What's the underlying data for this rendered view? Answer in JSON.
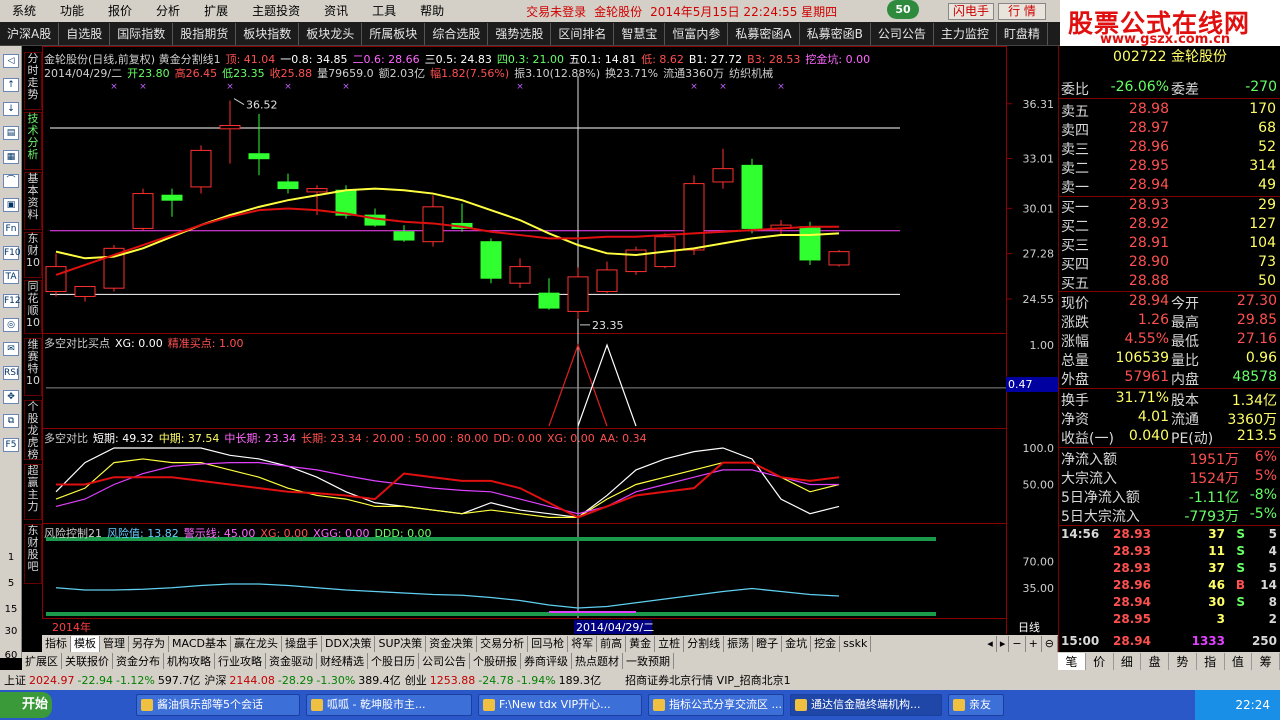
{
  "menu": [
    "系统",
    "功能",
    "报价",
    "分析",
    "扩展",
    "主题投资",
    "资讯",
    "工具",
    "帮助"
  ],
  "menu_status": {
    "login": "交易未登录",
    "stock": "金轮股份",
    "datetime": "2014年5月15日 22:24:55 星期四",
    "badge": "50",
    "flash": "闪电手",
    "quote": "行 情"
  },
  "logo": {
    "title": "股票公式在线网",
    "url": "www.gszx.com.cn"
  },
  "toolbar": [
    "沪深A股",
    "自选股",
    "国际指数",
    "股指期货",
    "板块指数",
    "板块龙头",
    "所属板块",
    "综合选股",
    "强势选股",
    "区间排名",
    "智慧宝",
    "恒富内参",
    "私募密函A",
    "私募密函B",
    "公司公告",
    "主力监控",
    "盯盘精"
  ],
  "left_tabs": [
    "分时走势",
    "技术分析",
    "基本资料",
    "东财10",
    "同花顺10",
    "维赛特10",
    "个股龙虎榜",
    "超赢主力",
    "东财股吧"
  ],
  "left_icons": [
    "◁",
    "↑",
    "↓",
    "▤",
    "▦",
    "⌒",
    "▣",
    "Fn",
    "F10",
    "TA",
    "F12",
    "◎",
    "✉",
    "RSI",
    "✥",
    "⧉",
    "F5"
  ],
  "left_numbers": [
    "1",
    "5",
    "15",
    "30",
    "60"
  ],
  "main_header": {
    "line1": [
      {
        "t": "金轮股份(日线,前复权) 黄金分割线1",
        "c": "#cfcfcf"
      },
      {
        "t": "顶: 41.04",
        "c": "#ff5050"
      },
      {
        "t": "一0.8: 34.85",
        "c": "#ffffff"
      },
      {
        "t": "二0.6: 28.66",
        "c": "#ff66ff"
      },
      {
        "t": "三0.5: 24.83",
        "c": "#ffffff"
      },
      {
        "t": "四0.3: 21.00",
        "c": "#66ff66"
      },
      {
        "t": "五0.1: 14.81",
        "c": "#ffffff"
      },
      {
        "t": "低: 8.62",
        "c": "#ff5050"
      },
      {
        "t": "B1: 27.72",
        "c": "#ffffff"
      },
      {
        "t": "B3: 28.53",
        "c": "#ff5050"
      },
      {
        "t": "挖金坑: 0.00",
        "c": "#ff66ff"
      }
    ],
    "line2": [
      {
        "t": "2014/04/29/二",
        "c": "#cfcfcf"
      },
      {
        "t": "开23.80",
        "c": "#66ff66"
      },
      {
        "t": "高26.45",
        "c": "#ff5050"
      },
      {
        "t": "低23.35",
        "c": "#66ff66"
      },
      {
        "t": "收25.88",
        "c": "#ff5050"
      },
      {
        "t": "量79659.0",
        "c": "#cfcfcf"
      },
      {
        "t": "额2.03亿",
        "c": "#cfcfcf"
      },
      {
        "t": "幅1.82(7.56%)",
        "c": "#ff5050"
      },
      {
        "t": "振3.10(12.88%)",
        "c": "#cfcfcf"
      },
      {
        "t": "换23.71%",
        "c": "#cfcfcf"
      },
      {
        "t": "流通3360万",
        "c": "#cfcfcf"
      },
      {
        "t": "纺织机械",
        "c": "#cfcfcf"
      }
    ]
  },
  "price_axis": [
    "36.31",
    "33.01",
    "30.01",
    "27.28",
    "24.55"
  ],
  "annotations": {
    "high": "36.52",
    "low": "23.35"
  },
  "chart_data": {
    "type": "candlestick",
    "ylim": [
      22.5,
      37.5
    ],
    "candles": [
      {
        "o": 25.0,
        "h": 27.3,
        "l": 24.7,
        "c": 26.5
      },
      {
        "o": 24.7,
        "h": 25.3,
        "l": 24.4,
        "c": 25.3
      },
      {
        "o": 25.2,
        "h": 27.8,
        "l": 25.0,
        "c": 27.6
      },
      {
        "o": 28.8,
        "h": 31.2,
        "l": 28.7,
        "c": 30.9
      },
      {
        "o": 30.8,
        "h": 31.2,
        "l": 29.5,
        "c": 30.5
      },
      {
        "o": 31.3,
        "h": 33.8,
        "l": 30.9,
        "c": 33.5
      },
      {
        "o": 34.8,
        "h": 36.5,
        "l": 32.7,
        "c": 35.0
      },
      {
        "o": 33.3,
        "h": 35.7,
        "l": 32.0,
        "c": 33.0
      },
      {
        "o": 31.6,
        "h": 32.1,
        "l": 30.9,
        "c": 31.2
      },
      {
        "o": 31.0,
        "h": 31.4,
        "l": 29.6,
        "c": 31.2
      },
      {
        "o": 31.1,
        "h": 31.4,
        "l": 29.4,
        "c": 29.6
      },
      {
        "o": 29.6,
        "h": 30.0,
        "l": 28.9,
        "c": 29.0
      },
      {
        "o": 28.6,
        "h": 29.0,
        "l": 28.0,
        "c": 28.1
      },
      {
        "o": 28.0,
        "h": 30.8,
        "l": 27.7,
        "c": 30.1
      },
      {
        "o": 29.1,
        "h": 30.3,
        "l": 28.6,
        "c": 28.8
      },
      {
        "o": 28.0,
        "h": 28.2,
        "l": 25.5,
        "c": 25.8
      },
      {
        "o": 25.5,
        "h": 27.0,
        "l": 25.2,
        "c": 26.5
      },
      {
        "o": 24.9,
        "h": 25.8,
        "l": 23.9,
        "c": 24.0
      },
      {
        "o": 23.8,
        "h": 26.45,
        "l": 23.35,
        "c": 25.88
      },
      {
        "o": 25.0,
        "h": 26.8,
        "l": 24.9,
        "c": 26.3
      },
      {
        "o": 26.2,
        "h": 27.7,
        "l": 26.0,
        "c": 27.5
      },
      {
        "o": 26.5,
        "h": 28.5,
        "l": 26.4,
        "c": 28.3
      },
      {
        "o": 27.5,
        "h": 32.0,
        "l": 27.2,
        "c": 31.5
      },
      {
        "o": 31.6,
        "h": 33.6,
        "l": 31.2,
        "c": 32.4
      },
      {
        "o": 32.6,
        "h": 33.0,
        "l": 28.5,
        "c": 28.8
      },
      {
        "o": 28.8,
        "h": 29.3,
        "l": 28.4,
        "c": 29.0
      },
      {
        "o": 28.9,
        "h": 29.2,
        "l": 26.6,
        "c": 26.9
      },
      {
        "o": 26.6,
        "h": 27.5,
        "l": 26.5,
        "c": 27.4
      }
    ],
    "ma_yellow": [
      27.4,
      27.0,
      27.1,
      27.6,
      28.3,
      29.0,
      29.6,
      30.1,
      30.5,
      30.8,
      31.1,
      31.2,
      31.1,
      30.9,
      30.5,
      29.9,
      29.3,
      28.5,
      27.8,
      27.3,
      27.2,
      27.4,
      27.6,
      27.9,
      28.2,
      28.4,
      28.4,
      28.5
    ],
    "ma_red": [
      26.0,
      26.6,
      27.2,
      27.8,
      28.4,
      29.0,
      29.5,
      29.9,
      30.0,
      29.9,
      29.7,
      29.4,
      29.2,
      29.1,
      28.9,
      28.6,
      28.4,
      28.2,
      28.2,
      28.3,
      28.3,
      28.4,
      28.5,
      28.6,
      28.7,
      28.8,
      28.9,
      28.9
    ],
    "hlines": [
      {
        "v": 34.85,
        "c": "#ffffff"
      },
      {
        "v": 28.66,
        "c": "#ff44ff"
      },
      {
        "v": 24.83,
        "c": "#ffffff"
      }
    ]
  },
  "panel2": {
    "header": [
      {
        "t": "多空对比买点",
        "c": "#cfcfcf"
      },
      {
        "t": "XG: 0.00",
        "c": "#ffffff"
      },
      {
        "t": "精准买点: 1.00",
        "c": "#ff5050"
      }
    ],
    "axis": [
      "1.00",
      "0.47"
    ],
    "value_box": "0.47"
  },
  "panel3": {
    "header": [
      {
        "t": "多空对比",
        "c": "#cfcfcf"
      },
      {
        "t": "短期: 49.32",
        "c": "#ffffff"
      },
      {
        "t": "中期: 37.54",
        "c": "#ffff66"
      },
      {
        "t": "中长期: 23.34",
        "c": "#ff66ff"
      },
      {
        "t": "长期: 23.34 : 20.00 : 50.00 : 80.00",
        "c": "#ff5050"
      },
      {
        "t": "DD: 0.00",
        "c": "#ff5050"
      },
      {
        "t": "XG: 0.00",
        "c": "#ff5050"
      },
      {
        "t": "AA: 0.34",
        "c": "#ff5050"
      }
    ],
    "axis": [
      "100.0",
      "50.00"
    ]
  },
  "panel4": {
    "header": [
      {
        "t": "风险控制21",
        "c": "#cfcfcf"
      },
      {
        "t": "风险值: 13.82",
        "c": "#66ccff"
      },
      {
        "t": "警示线: 45.00",
        "c": "#ff66ff"
      },
      {
        "t": "XG: 0.00",
        "c": "#ff5050"
      },
      {
        "t": "XGG: 0.00",
        "c": "#ff66ff"
      },
      {
        "t": "DDD: 0.00",
        "c": "#66ff66"
      }
    ],
    "axis": [
      "70.00",
      "35.00"
    ]
  },
  "xaxis": {
    "year": "2014年",
    "cursor": "2014/04/29/二",
    "period": "日线"
  },
  "quote": {
    "code": "002722 金轮股份",
    "weibi": {
      "l": "委比",
      "v": "-26.06%",
      "l2": "委差",
      "v2": "-270"
    },
    "sell": [
      {
        "l": "卖五",
        "p": "28.98",
        "q": "170"
      },
      {
        "l": "卖四",
        "p": "28.97",
        "q": "68"
      },
      {
        "l": "卖三",
        "p": "28.96",
        "q": "52"
      },
      {
        "l": "卖二",
        "p": "28.95",
        "q": "314"
      },
      {
        "l": "卖一",
        "p": "28.94",
        "q": "49"
      }
    ],
    "buy": [
      {
        "l": "买一",
        "p": "28.93",
        "q": "29"
      },
      {
        "l": "买二",
        "p": "28.92",
        "q": "127"
      },
      {
        "l": "买三",
        "p": "28.91",
        "q": "104"
      },
      {
        "l": "买四",
        "p": "28.90",
        "q": "73"
      },
      {
        "l": "买五",
        "p": "28.88",
        "q": "50"
      }
    ],
    "stats": [
      {
        "l": "现价",
        "v": "28.94",
        "vc": "#ff5050",
        "l2": "今开",
        "v2": "27.30",
        "v2c": "#ff5050"
      },
      {
        "l": "涨跌",
        "v": "1.26",
        "vc": "#ff5050",
        "l2": "最高",
        "v2": "29.85",
        "v2c": "#ff5050"
      },
      {
        "l": "涨幅",
        "v": "4.55%",
        "vc": "#ff5050",
        "l2": "最低",
        "v2": "27.16",
        "v2c": "#ff5050"
      },
      {
        "l": "总量",
        "v": "106539",
        "vc": "#ffff66",
        "l2": "量比",
        "v2": "0.96",
        "v2c": "#ffff66"
      },
      {
        "l": "外盘",
        "v": "57961",
        "vc": "#ff5050",
        "l2": "内盘",
        "v2": "48578",
        "v2c": "#66ff66"
      }
    ],
    "stats2": [
      {
        "l": "换手",
        "v": "31.71%",
        "vc": "#ffff66",
        "l2": "股本",
        "v2": "1.34亿",
        "v2c": "#ffff66"
      },
      {
        "l": "净资",
        "v": "4.01",
        "vc": "#ffff66",
        "l2": "流通",
        "v2": "3360万",
        "v2c": "#ffff66"
      },
      {
        "l": "收益(一)",
        "v": "0.040",
        "vc": "#ffff66",
        "l2": "PE(动)",
        "v2": "213.5",
        "v2c": "#ffff66"
      }
    ],
    "flows": [
      {
        "l": "净流入额",
        "v": "1951万",
        "p": "6%",
        "c": "#ff5050"
      },
      {
        "l": "大宗流入",
        "v": "1524万",
        "p": "5%",
        "c": "#ff5050"
      },
      {
        "l": "5日净流入额",
        "v": "-1.11亿",
        "p": "-8%",
        "c": "#66ff66"
      },
      {
        "l": "5日大宗流入",
        "v": "-7793万",
        "p": "-5%",
        "c": "#66ff66"
      }
    ],
    "ticks": [
      {
        "t": "14:56",
        "p": "28.93",
        "q": "37",
        "s": "S",
        "n": "5"
      },
      {
        "t": "",
        "p": "28.93",
        "q": "11",
        "s": "S",
        "n": "4"
      },
      {
        "t": "",
        "p": "28.93",
        "q": "37",
        "s": "S",
        "n": "5"
      },
      {
        "t": "",
        "p": "28.96",
        "q": "46",
        "s": "B",
        "n": "14"
      },
      {
        "t": "",
        "p": "28.94",
        "q": "30",
        "s": "S",
        "n": "8"
      },
      {
        "t": "",
        "p": "28.95",
        "q": "3",
        "s": "",
        "n": "2"
      },
      {
        "t": "15:00",
        "p": "28.94",
        "q": "1333",
        "s": "",
        "n": "250"
      }
    ]
  },
  "right_tabs": [
    "笔",
    "价",
    "细",
    "盘",
    "势",
    "指",
    "值",
    "筹"
  ],
  "bottom_tabs1": [
    "指标",
    "模板",
    "管理",
    "另存为",
    "MACD基本",
    "赢在龙头",
    "操盘手",
    "DDX决策",
    "SUP决策",
    "资金决策",
    "交易分析",
    "回马枪",
    "将军",
    "前高",
    "黄金",
    "立桩",
    "分割线",
    "振荡",
    "瞪子",
    "金坑",
    "挖金",
    "sskk"
  ],
  "bottom_tabs1_right": [
    "◂",
    "▸",
    "−",
    "+",
    "⊖"
  ],
  "bottom_tabs2": [
    "扩展区",
    "关联报价",
    "资金分布",
    "机构攻略",
    "行业攻略",
    "资金驱动",
    "财经精选",
    "个股日历",
    "公司公告",
    "个股研报",
    "券商评级",
    "热点题材",
    "一致预期"
  ],
  "status_bar": [
    {
      "t": "上证",
      "c": "#000"
    },
    {
      "t": "2024.97",
      "c": "#c00000"
    },
    {
      "t": "-22.94",
      "c": "#008000"
    },
    {
      "t": "-1.12%",
      "c": "#008000"
    },
    {
      "t": "597.7亿",
      "c": "#000"
    },
    {
      "t": "沪深",
      "c": "#000"
    },
    {
      "t": "2144.08",
      "c": "#c00000"
    },
    {
      "t": "-28.29",
      "c": "#008000"
    },
    {
      "t": "-1.30%",
      "c": "#008000"
    },
    {
      "t": "389.4亿",
      "c": "#000"
    },
    {
      "t": "创业",
      "c": "#000"
    },
    {
      "t": "1253.88",
      "c": "#c00000"
    },
    {
      "t": "-24.78",
      "c": "#008000"
    },
    {
      "t": "-1.94%",
      "c": "#008000"
    },
    {
      "t": "189.3亿",
      "c": "#000"
    },
    {
      "t": "招商证券北京行情 VIP_招商北京1",
      "c": "#000"
    }
  ],
  "taskbar": {
    "start": "开始",
    "tasks": [
      "酱油俱乐部等5个会话",
      "呱呱 - 乾坤股市主...",
      "F:\\New tdx VIP开心...",
      "指标公式分享交流区 ...",
      "通达信金融终端机构...",
      "亲友"
    ],
    "clock": "22:24"
  }
}
